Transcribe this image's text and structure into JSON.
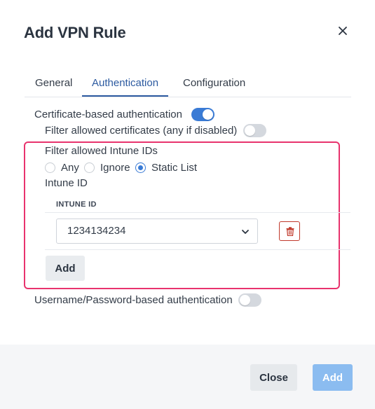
{
  "dialog": {
    "title": "Add VPN Rule"
  },
  "tabs": [
    {
      "label": "General",
      "active": false
    },
    {
      "label": "Authentication",
      "active": true
    },
    {
      "label": "Configuration",
      "active": false
    }
  ],
  "auth": {
    "certificate_label": "Certificate-based authentication",
    "certificate_enabled": true,
    "filter_certs_label": "Filter allowed certificates (any if disabled)",
    "filter_certs_enabled": false,
    "intune_filter_label": "Filter allowed Intune IDs",
    "intune_options": [
      {
        "label": "Any",
        "checked": false
      },
      {
        "label": "Ignore",
        "checked": false
      },
      {
        "label": "Static List",
        "checked": true
      }
    ],
    "intune_id_label": "Intune ID",
    "table": {
      "column_header": "INTUNE ID",
      "rows": [
        {
          "value": "1234134234"
        }
      ]
    },
    "add_row_label": "Add",
    "username_label": "Username/Password-based authentication",
    "username_enabled": false
  },
  "footer": {
    "close_label": "Close",
    "add_label": "Add"
  },
  "colors": {
    "accent": "#3a7bd5",
    "highlight_border": "#e8336d",
    "danger": "#c0392b",
    "add_button_disabled": "#8bbcf0"
  },
  "icons": {
    "close": "close-icon",
    "chevron": "chevron-down-icon",
    "delete": "trash-icon"
  }
}
